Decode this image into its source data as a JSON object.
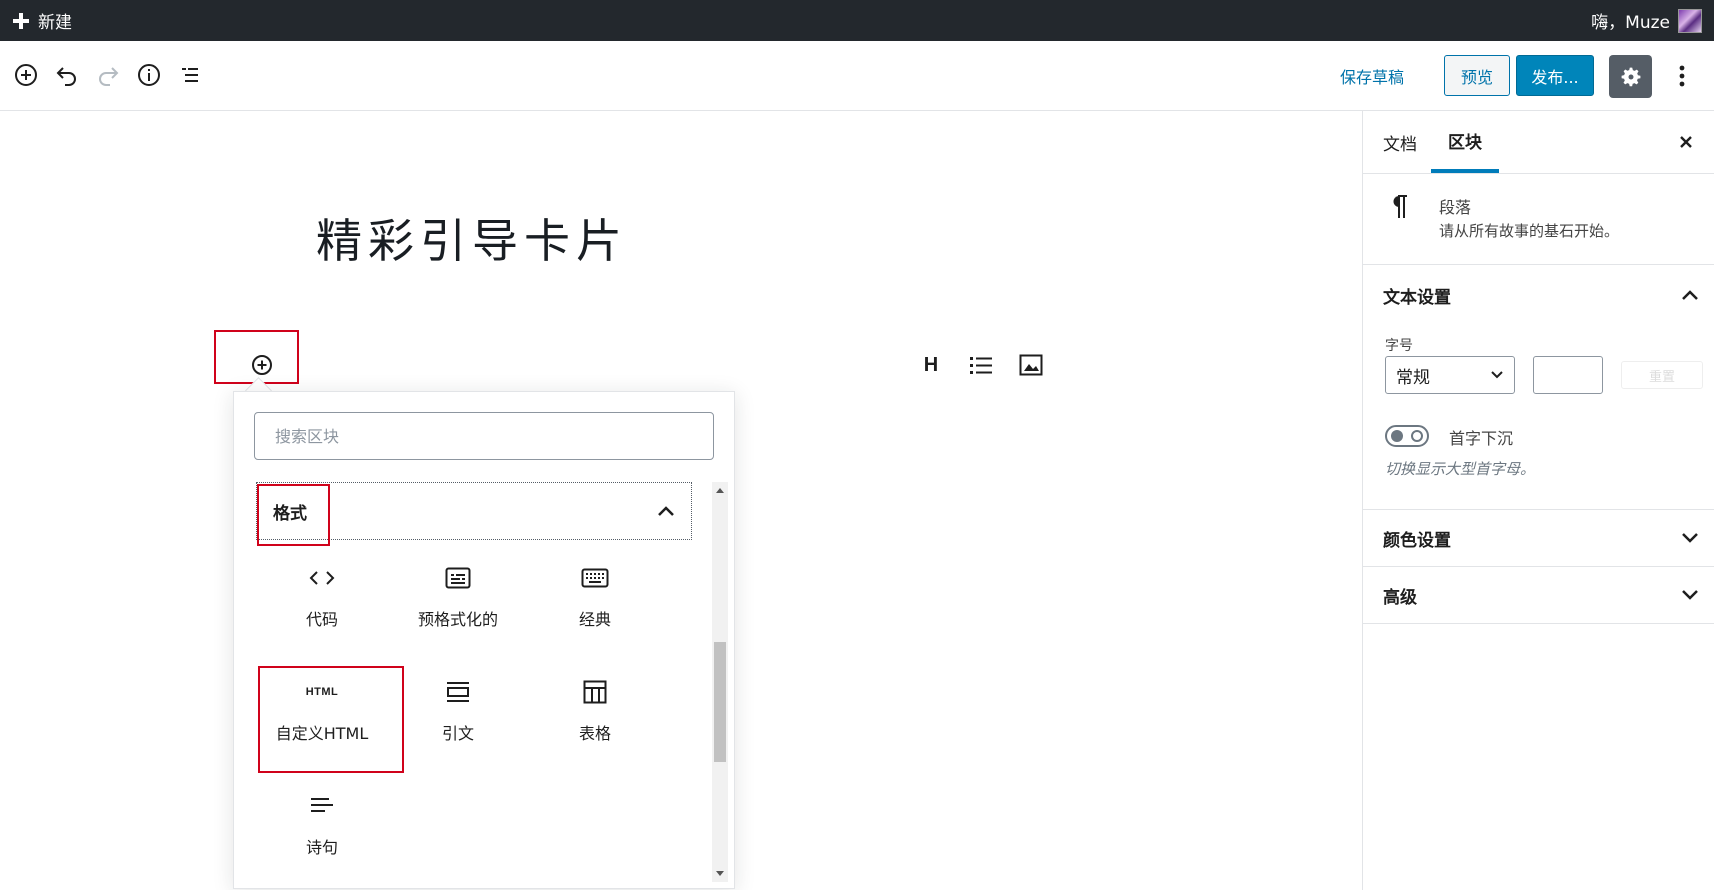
{
  "adminbar": {
    "new_label": "新建",
    "greeting": "嗨，Muze"
  },
  "toolbar": {
    "save_draft": "保存草稿",
    "preview": "预览",
    "publish": "发布..."
  },
  "post": {
    "title": "精彩引导卡片"
  },
  "inserter": {
    "search_placeholder": "搜索区块",
    "panel_title": "格式",
    "blocks": [
      {
        "label": "代码",
        "icon": "code-icon"
      },
      {
        "label": "预格式化的",
        "icon": "preformatted-icon"
      },
      {
        "label": "经典",
        "icon": "keyboard-icon"
      },
      {
        "label": "自定义HTML",
        "icon": "html-icon",
        "icon_text": "HTML"
      },
      {
        "label": "引文",
        "icon": "pullquote-icon"
      },
      {
        "label": "表格",
        "icon": "table-icon"
      },
      {
        "label": "诗句",
        "icon": "verse-icon"
      }
    ]
  },
  "quick_inserter": [
    {
      "icon": "heading-icon",
      "glyph": "H"
    },
    {
      "icon": "list-icon"
    },
    {
      "icon": "image-icon"
    }
  ],
  "sidebar": {
    "tabs": [
      "文档",
      "区块"
    ],
    "active_tab": "区块",
    "block_card": {
      "name": "段落",
      "description": "请从所有故事的基石开始。"
    },
    "text_settings": {
      "title": "文本设置",
      "font_size_label": "字号",
      "font_size_value": "常规",
      "reset_label": "重置",
      "drop_cap_label": "首字下沉",
      "drop_cap_help": "切换显示大型首字母。"
    },
    "color_settings": {
      "title": "颜色设置"
    },
    "advanced": {
      "title": "高级"
    }
  },
  "colors": {
    "accent": "#0085ba",
    "adminbar": "#23282d",
    "highlight_box": "#d0021b"
  }
}
